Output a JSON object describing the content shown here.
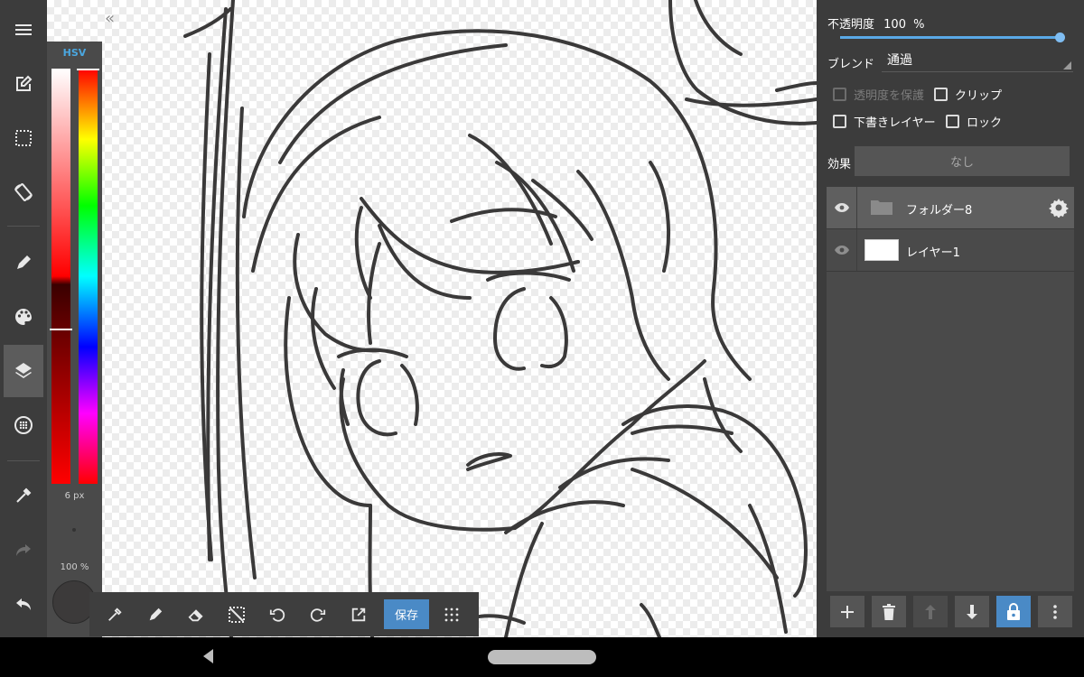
{
  "colors": {
    "accent": "#4a8ac6",
    "slider": "#5aa9e6",
    "panel_bg": "#3c3c3c",
    "layer_list_bg": "#4a4a4a",
    "current_color": "#3c3a3a"
  },
  "left_toolbar": {
    "icons": [
      "menu-icon",
      "new-canvas-icon",
      "selection-icon",
      "rotate-canvas-icon",
      "brush-icon",
      "palette-icon",
      "layers-icon",
      "material-icon",
      "eyedropper-icon",
      "redo-icon",
      "undo-icon"
    ],
    "active": "layers-icon"
  },
  "color_panel": {
    "mode_tab": "HSV",
    "brush_size": "6 px",
    "brush_opacity": "100 %",
    "value_level": 0.63,
    "hue_level": 0.0
  },
  "bottom_toolbar": {
    "icons": [
      "eyedropper-icon",
      "pen-icon",
      "eraser-icon",
      "deselect-icon",
      "undo-icon",
      "redo-icon",
      "transform-icon",
      "grid-icon"
    ],
    "save_label": "保存"
  },
  "layer_properties": {
    "opacity_label": "不透明度",
    "opacity_value": "100",
    "opacity_unit": "%",
    "opacity_level": 1.0,
    "blend_label": "ブレンド",
    "blend_value": "通過",
    "protect_alpha_label": "透明度を保護",
    "clip_label": "クリップ",
    "draft_layer_label": "下書きレイヤー",
    "lock_label": "ロック",
    "effect_label": "効果",
    "effect_value": "なし"
  },
  "layers": [
    {
      "name": "フォルダー8",
      "type": "folder",
      "visible": true,
      "selected": true
    },
    {
      "name": "レイヤー1",
      "type": "layer",
      "visible": true,
      "selected": false
    }
  ],
  "layer_actions": [
    "add-layer-icon",
    "delete-layer-icon",
    "move-up-icon",
    "move-down-icon",
    "lock-icon",
    "more-icon"
  ]
}
